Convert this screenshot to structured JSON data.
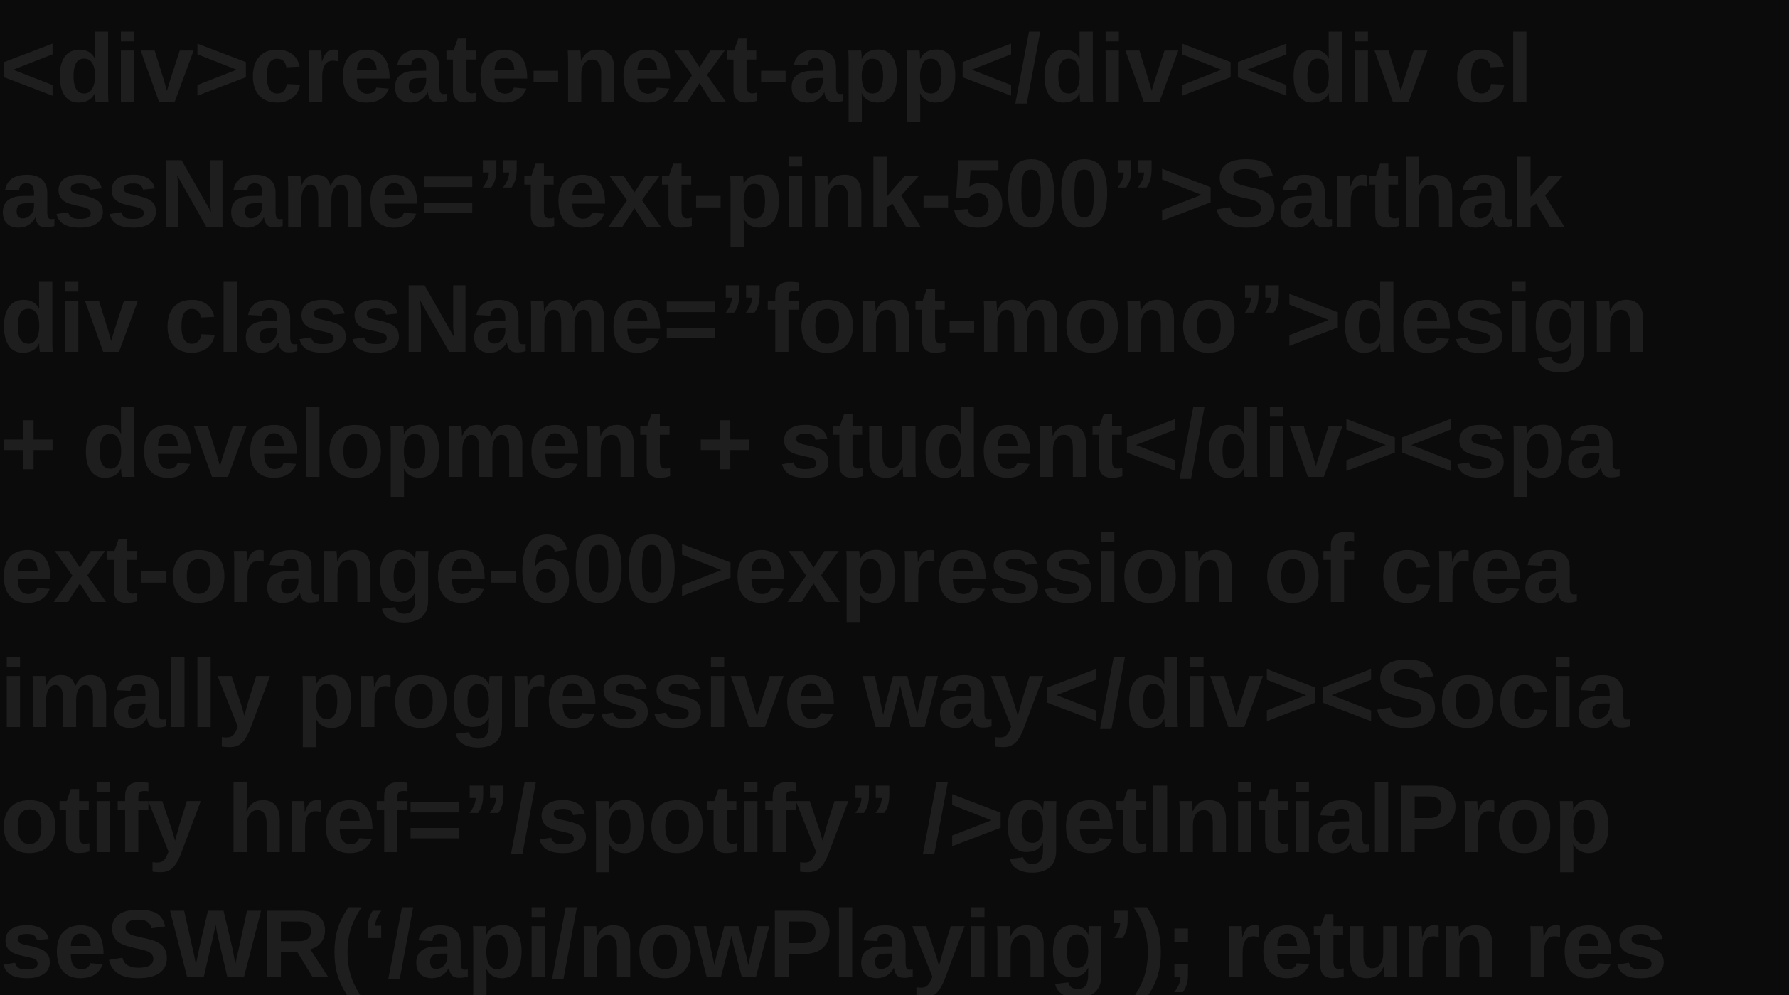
{
  "background_color": "#0b0b0b",
  "text_color": "#1e1e1e",
  "code_lines": [
    "<div>create-next-app</div><div cl",
    "assName=”text-pink-500”>Sarthak",
    "div className=”font-mono”>design",
    "+ development + student</div><spa",
    "ext-orange-600>expression of crea",
    "imally progressive way</div><Socia",
    "otify href=”/spotify” />getInitialProp",
    "seSWR(‘/api/nowPlaying’); return res"
  ]
}
